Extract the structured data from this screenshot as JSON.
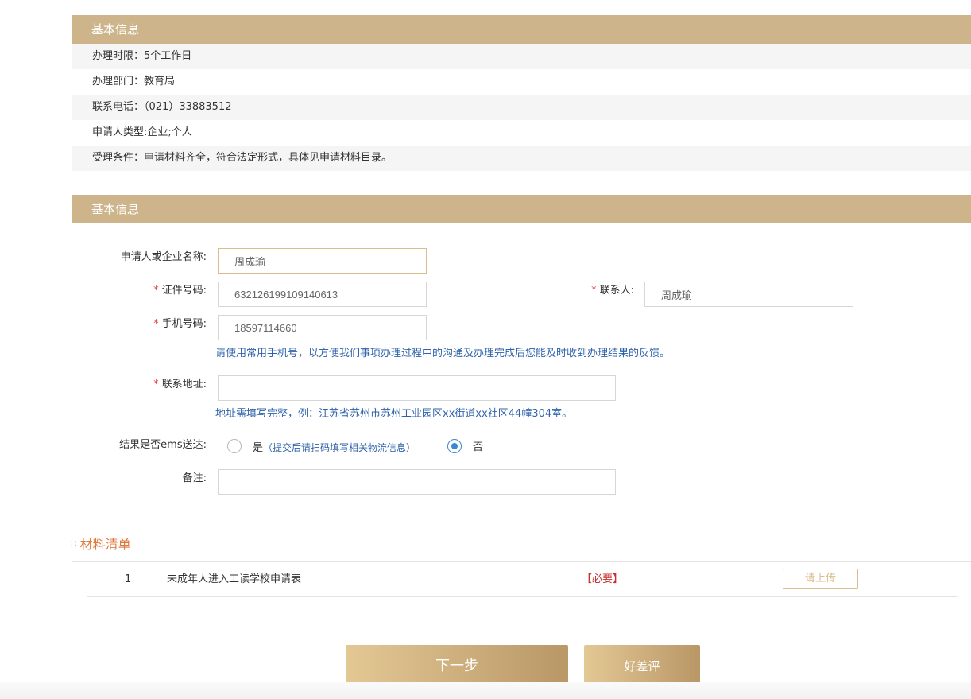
{
  "basic_info": {
    "header": "基本信息",
    "rows": [
      "办理时限：5个工作日",
      "办理部门：教育局",
      "联系电话：（021）33883512",
      "申请人类型:企业;个人",
      "受理条件：申请材料齐全，符合法定形式，具体见申请材料目录。"
    ]
  },
  "form": {
    "header": "基本信息",
    "required_mark": "*",
    "applicant_name": {
      "label": "申请人或企业名称:",
      "value": "周成瑜"
    },
    "id_number": {
      "label": "证件号码:",
      "value": "632126199109140613"
    },
    "contact": {
      "label": "联系人:",
      "value": "周成瑜"
    },
    "phone": {
      "label": "手机号码:",
      "value": "18597114660",
      "hint": "请使用常用手机号，以方便我们事项办理过程中的沟通及办理完成后您能及时收到办理结果的反馈。"
    },
    "address": {
      "label": "联系地址:",
      "value": "",
      "hint": "地址需填写完整，例：江苏省苏州市苏州工业园区xx街道xx社区44幢304室。"
    },
    "ems": {
      "label": "结果是否ems送达:",
      "yes_label": "是",
      "yes_note": "（提交后请扫码填写相关物流信息）",
      "no_label": "否",
      "selected": "no"
    },
    "remark": {
      "label": "备注:",
      "value": ""
    }
  },
  "materials": {
    "title": "材料清单",
    "title_marker": "∷",
    "items": [
      {
        "index": "1",
        "name": "未成年人进入工读学校申请表",
        "required": "【必要】",
        "action": "请上传"
      }
    ]
  },
  "actions": {
    "next": "下一步",
    "rating": "好差评"
  },
  "colors": {
    "header_bg": "#cdb48a",
    "hint": "#2f63ab",
    "required": "#e4393c",
    "materials_title": "#e07a3b",
    "radio_checked": "#3b87d6"
  }
}
